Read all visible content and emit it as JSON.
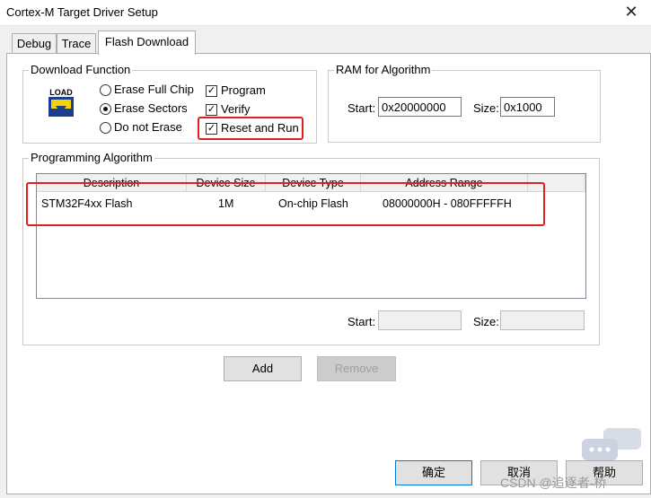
{
  "window": {
    "title": "Cortex-M Target Driver Setup",
    "close_glyph": "✕"
  },
  "tabs": [
    {
      "label": "Debug"
    },
    {
      "label": "Trace"
    },
    {
      "label": "Flash Download"
    }
  ],
  "download_function": {
    "title": "Download Function",
    "icon_text": "LOAD",
    "radios": [
      {
        "label": "Erase Full Chip",
        "selected": false
      },
      {
        "label": "Erase Sectors",
        "selected": true
      },
      {
        "label": "Do not Erase",
        "selected": false
      }
    ],
    "checks": [
      {
        "label": "Program",
        "checked": true
      },
      {
        "label": "Verify",
        "checked": true
      },
      {
        "label": "Reset and Run",
        "checked": true
      }
    ]
  },
  "ram": {
    "title": "RAM for Algorithm",
    "start_label": "Start:",
    "start_value": "0x20000000",
    "size_label": "Size:",
    "size_value": "0x1000"
  },
  "programming": {
    "title": "Programming Algorithm",
    "columns": [
      "Description",
      "Device Size",
      "Device Type",
      "Address Range"
    ],
    "rows": [
      {
        "description": "STM32F4xx Flash",
        "size": "1M",
        "type": "On-chip Flash",
        "range": "08000000H - 080FFFFFH"
      }
    ],
    "start_label": "Start:",
    "start_value": "",
    "size_label": "Size:",
    "size_value": ""
  },
  "buttons": {
    "add": "Add",
    "remove": "Remove",
    "ok": "确定",
    "cancel": "取消",
    "help": "帮助"
  },
  "check_glyph": "✓",
  "watermark": "CSDN @追逐者-桥",
  "colors": {
    "highlight": "#e02020",
    "accent": "#0078d7"
  }
}
